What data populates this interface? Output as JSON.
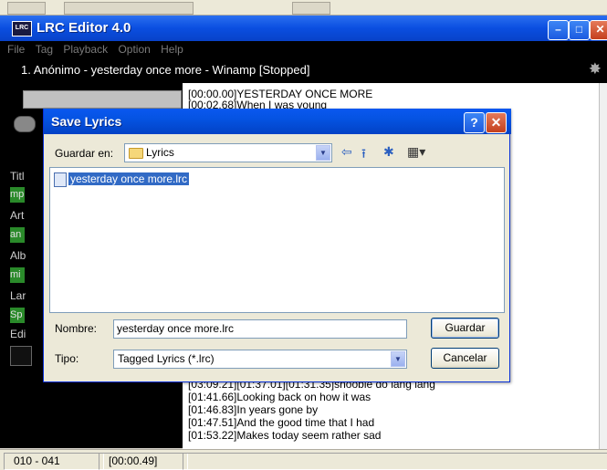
{
  "app": {
    "title": "LRC Editor 4.0",
    "icon_text": "LRC"
  },
  "menubar": [
    "File",
    "Tag",
    "Playback",
    "Option",
    "Help"
  ],
  "now_playing": "1. Anónimo - yesterday once more - Winamp [Stopped]",
  "left_panel": {
    "labels": [
      "Titl",
      "Art",
      "Alb",
      "Lar",
      "Edi"
    ],
    "fields": [
      "mp",
      "an",
      "mi",
      "Sp"
    ]
  },
  "lyrics": {
    "top_lines": [
      "[00:00.00]YESTERDAY ONCE MORE",
      "[00:02.68]When I was young"
    ],
    "bottom_lines": [
      "[03:09.21][01:37.01][01:31.35]shoobie do lang lang",
      "[01:41.66]Looking back on how it was",
      "[01:46.83]In years gone by",
      "[01:47.51]And the good time that I had",
      "[01:53.22]Makes today seem rather sad"
    ]
  },
  "status": {
    "range": "010 - 041",
    "time": "[00:00.49]"
  },
  "dialog": {
    "title": "Save Lyrics",
    "help_label": "?",
    "save_in_label": "Guardar en:",
    "save_in_value": "Lyrics",
    "files": [
      "yesterday once more.lrc"
    ],
    "name_label": "Nombre:",
    "name_value": "yesterday once more.lrc",
    "type_label": "Tipo:",
    "type_value": "Tagged Lyrics (*.lrc)",
    "save_button": "Guardar",
    "cancel_button": "Cancelar"
  }
}
